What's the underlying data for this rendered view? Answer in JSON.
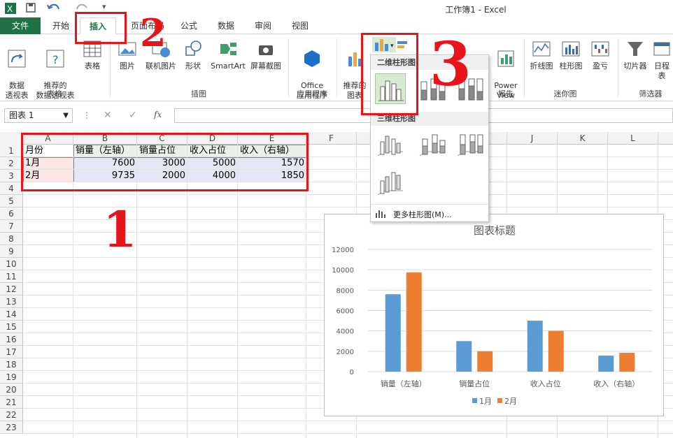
{
  "window": {
    "title": "工作簿1 - Excel"
  },
  "tabs": [
    {
      "label": "文件"
    },
    {
      "label": "开始"
    },
    {
      "label": "插入"
    },
    {
      "label": "页面布局"
    },
    {
      "label": "公式"
    },
    {
      "label": "数据"
    },
    {
      "label": "审阅"
    },
    {
      "label": "视图"
    }
  ],
  "ribbon": {
    "buttons": {
      "pivot": "数据\n透视表",
      "recommended_pivot": "推荐的\n数据透视表",
      "table": "表格",
      "picture": "图片",
      "online_picture": "联机图片",
      "shapes": "形状",
      "smartart": "SmartArt",
      "screenshot": "屏幕截图",
      "office_apps": "Office\n应用程序",
      "recommended_charts": "推荐的\n图表",
      "power_view": "Power\nView",
      "spark_line": "折线图",
      "spark_column": "柱形图",
      "spark_winloss": "盈亏",
      "slicer": "切片器",
      "timeline": "日程表"
    },
    "groups": {
      "tables": "表格",
      "illustrations": "插图",
      "apps": "应用程序",
      "reports": "报告",
      "sparklines": "迷你图",
      "filters": "筛选器"
    }
  },
  "formula_bar": {
    "name_box": "图表 1",
    "fx": "fx"
  },
  "columns": [
    "A",
    "B",
    "C",
    "D",
    "E",
    "F",
    "J",
    "K",
    "L"
  ],
  "rows": [
    "1",
    "2",
    "3",
    "4",
    "5",
    "6",
    "7",
    "8",
    "9",
    "10",
    "11",
    "12",
    "13",
    "14",
    "15",
    "16",
    "17",
    "18",
    "19",
    "20",
    "21",
    "22",
    "23"
  ],
  "table": {
    "headers": [
      "月份",
      "销量（左轴）",
      "销量占位",
      "收入占位",
      "收入（右轴）"
    ],
    "rows": [
      [
        "1月",
        "7600",
        "3000",
        "5000",
        "1570"
      ],
      [
        "2月",
        "9735",
        "2000",
        "4000",
        "1850"
      ]
    ]
  },
  "dropdown": {
    "section_2d": "二维柱形图",
    "section_3d": "三维柱形图",
    "more": "更多柱形图(M)..."
  },
  "annotations": [
    "1",
    "2",
    "3"
  ],
  "colors": {
    "excel_green": "#217346",
    "series_1": "#5b9bd5",
    "series_2": "#ed7d31",
    "annotation_red": "#e8141a"
  },
  "chart_data": {
    "type": "bar",
    "title": "图表标题",
    "categories": [
      "销量（左轴）",
      "销量占位",
      "收入占位",
      "收入（右轴）"
    ],
    "series": [
      {
        "name": "1月",
        "values": [
          7600,
          3000,
          5000,
          1570
        ]
      },
      {
        "name": "2月",
        "values": [
          9735,
          2000,
          4000,
          1850
        ]
      }
    ],
    "ylim": [
      0,
      12000
    ],
    "yticks": [
      "0",
      "2000",
      "4000",
      "6000",
      "8000",
      "10000",
      "12000"
    ],
    "grid": true,
    "legend": "bottom"
  }
}
